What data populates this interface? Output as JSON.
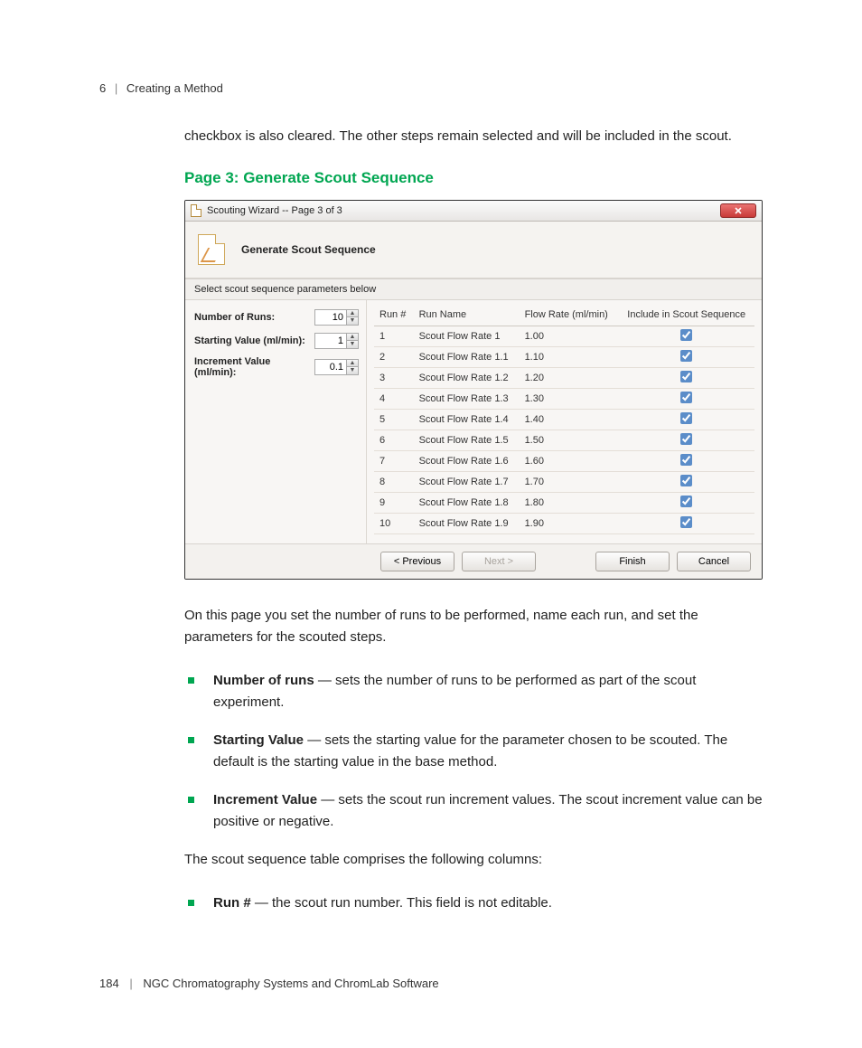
{
  "header": {
    "chapter_num": "6",
    "chapter_title": "Creating a Method"
  },
  "intro_para": "checkbox is also cleared. The other steps remain selected and will be included in the scout.",
  "section_heading": "Page 3: Generate Scout Sequence",
  "wizard": {
    "title": "Scouting Wizard -- Page 3 of 3",
    "banner_title": "Generate Scout Sequence",
    "subhead": "Select scout sequence parameters below",
    "params": {
      "runs_label": "Number of Runs:",
      "runs_value": "10",
      "start_label": "Starting Value (ml/min):",
      "start_value": "1",
      "incr_label": "Increment Value (ml/min):",
      "incr_value": "0.1"
    },
    "columns": {
      "c1": "Run #",
      "c2": "Run Name",
      "c3": "Flow Rate (ml/min)",
      "c4": "Include in Scout Sequence"
    },
    "rows": [
      {
        "n": "1",
        "name": "Scout Flow Rate 1",
        "rate": "1.00"
      },
      {
        "n": "2",
        "name": "Scout Flow Rate 1.1",
        "rate": "1.10"
      },
      {
        "n": "3",
        "name": "Scout Flow Rate 1.2",
        "rate": "1.20"
      },
      {
        "n": "4",
        "name": "Scout Flow Rate 1.3",
        "rate": "1.30"
      },
      {
        "n": "5",
        "name": "Scout Flow Rate 1.4",
        "rate": "1.40"
      },
      {
        "n": "6",
        "name": "Scout Flow Rate 1.5",
        "rate": "1.50"
      },
      {
        "n": "7",
        "name": "Scout Flow Rate 1.6",
        "rate": "1.60"
      },
      {
        "n": "8",
        "name": "Scout Flow Rate 1.7",
        "rate": "1.70"
      },
      {
        "n": "9",
        "name": "Scout Flow Rate 1.8",
        "rate": "1.80"
      },
      {
        "n": "10",
        "name": "Scout Flow Rate 1.9",
        "rate": "1.90"
      }
    ],
    "buttons": {
      "prev": "< Previous",
      "next": "Next >",
      "finish": "Finish",
      "cancel": "Cancel"
    }
  },
  "after_para": "On this page you set the number of runs to be performed, name each run, and set the parameters for the scouted steps.",
  "bullets": [
    {
      "term": "Number of runs",
      "desc": " — sets the number of runs to be performed as part of the scout experiment."
    },
    {
      "term": "Starting Value",
      "desc": " — sets the starting value for the parameter chosen to be scouted. The default is the starting value in the base method."
    },
    {
      "term": "Increment Value",
      "desc": " — sets the scout run increment values. The scout increment value can be positive or negative."
    }
  ],
  "cols_para": "The scout sequence table comprises the following columns:",
  "bullets2": [
    {
      "term": "Run #",
      "desc": " — the scout run number. This field is not editable."
    }
  ],
  "footer": {
    "page": "184",
    "title": "NGC Chromatography Systems and ChromLab Software"
  }
}
